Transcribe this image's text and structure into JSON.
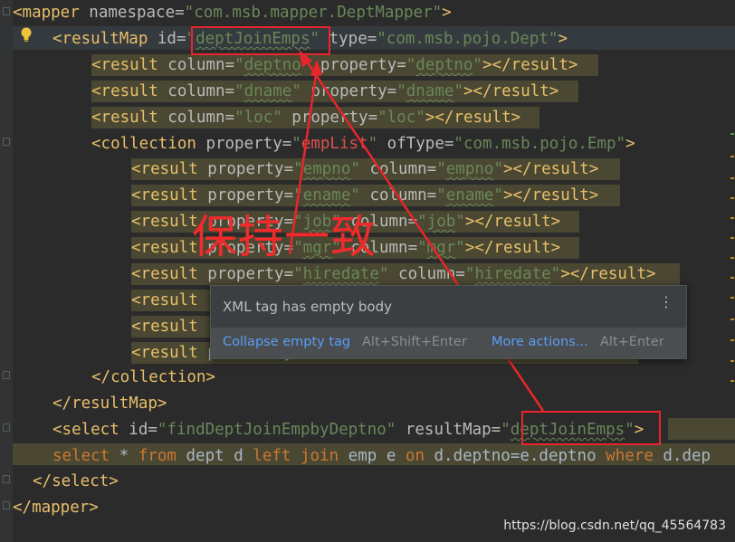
{
  "code": {
    "l1": {
      "tag_open": "<mapper",
      "attr_ns": " namespace=",
      "ns_val": "\"com.msb.mapper.DeptMapper\"",
      "tag_close": ">"
    },
    "l2": {
      "tag_open": "<resultMap",
      "attr_id": " id=",
      "q1": "\"",
      "id_val": "deptJoinEmps",
      "q2": "\"",
      "attr_type": " type=",
      "type_val": "\"com.msb.pojo.Dept\"",
      "tag_close": ">"
    },
    "l3": {
      "tag_open": "<result",
      "attr_col": " column=",
      "col_q1": "\"",
      "col_val": "deptno",
      "col_q2": "\"",
      "attr_prop": " property=",
      "prop_q1": "\"",
      "prop_val": "deptno",
      "prop_q2": "\"",
      "tag_close": "></result>"
    },
    "l4": {
      "tag_open": "<result",
      "attr_col": " column=",
      "col_q1": "\"",
      "col_val": "dname",
      "col_q2": "\"",
      "attr_prop": " property=",
      "prop_q1": "\"",
      "prop_val": "dname",
      "prop_q2": "\"",
      "tag_close": "></result>"
    },
    "l5": {
      "tag_open": "<result",
      "attr_col": " column=",
      "col_val": "\"loc\"",
      "attr_prop": " property=",
      "prop_val": "\"loc\"",
      "tag_close": "></result>"
    },
    "l6": {
      "tag_open": "<collection",
      "attr_prop": " property=",
      "q1": "\"",
      "prop_val": "empList",
      "q2": "\"",
      "attr_oftype": " ofType=",
      "oftype_val": "\"com.msb.pojo.Emp\"",
      "tag_close": ">"
    },
    "l7": {
      "tag_open": "<result",
      "attr_prop": " property=",
      "prop_q1": "\"",
      "prop_val": "empno",
      "prop_q2": "\"",
      "attr_col": " column=",
      "col_q1": "\"",
      "col_val": "empno",
      "col_q2": "\"",
      "tag_close": "></result>"
    },
    "l8": {
      "tag_open": "<result",
      "attr_prop": " property=",
      "prop_q1": "\"",
      "prop_val": "ename",
      "prop_q2": "\"",
      "attr_col": " column=",
      "col_q1": "\"",
      "col_val": "ename",
      "col_q2": "\"",
      "tag_close": "></result>"
    },
    "l9": {
      "tag_open": "<result",
      "attr_prop": " property=",
      "prop_q1": "\"",
      "prop_val": "job",
      "prop_q2": "\"",
      "attr_col": " column=",
      "col_q1": "\"",
      "col_val": "job",
      "col_q2": "\"",
      "tag_close": "></result>"
    },
    "l10": {
      "tag_open": "<result",
      "attr_prop": " property=",
      "prop_q1": "\"",
      "prop_val": "mgr",
      "prop_q2": "\"",
      "attr_col": " column=",
      "col_q1": "\"",
      "col_val": "mgr",
      "col_q2": "\"",
      "tag_close": "></result>"
    },
    "l11": {
      "tag_open": "<result",
      "attr_prop": " property=",
      "prop_q1": "\"",
      "prop_val": "hiredate",
      "prop_q2": "\"",
      "attr_col": " column=",
      "col_q1": "\"",
      "col_val": "hiredate",
      "col_q2": "\"",
      "tag_close": "></result>"
    },
    "l12": {
      "tag_open": "<result"
    },
    "l13": {
      "tag_open": "<result"
    },
    "l14": {
      "tag_open": "<result",
      "rest": " p       y       "
    },
    "l15": {
      "tag": "</collection>"
    },
    "l16": {
      "tag": "</resultMap>"
    },
    "l17": {
      "tag_open": "<select",
      "attr_id": " id=",
      "id_val": "\"findDeptJoinEmpbyDeptno\"",
      "attr_rm": " resultMap=",
      "q1": "\"",
      "rm_val": "deptJoinEmps",
      "q2": "\"",
      "tag_close": ">"
    },
    "l18": {
      "kw_select": "select",
      "t1": " * ",
      "kw_from": "from",
      "t2": " dept d ",
      "kw_left": "left",
      "sp1": " ",
      "kw_join": "join",
      "t3": " emp e ",
      "kw_on": "on",
      "t4": " d.deptno=e.deptno ",
      "kw_where": "where",
      "t5": " d.dep"
    },
    "l19": {
      "tag": "</select>"
    },
    "l20": {
      "tag": "</mapper>"
    }
  },
  "popup": {
    "message": "XML tag has empty body",
    "action1_label": "Collapse empty tag",
    "action1_shortcut": "Alt+Shift+Enter",
    "action2_label": "More actions...",
    "action2_shortcut": "Alt+Enter"
  },
  "annotation": {
    "text": "保持一致",
    "color": "#ef2b2b"
  },
  "watermark": "https://blog.csdn.net/qq_45564783",
  "colors": {
    "background": "#2b2b2b",
    "tag": "#e8bf6a",
    "string": "#6a8759",
    "attribute": "#bababa",
    "keyword": "#cc7832",
    "highlight": "#4a4832",
    "annotation": "#e8262b",
    "link": "#589df6"
  },
  "icons": [
    "lightbulb-icon",
    "more-vertical-icon",
    "fold-marker-icon"
  ]
}
